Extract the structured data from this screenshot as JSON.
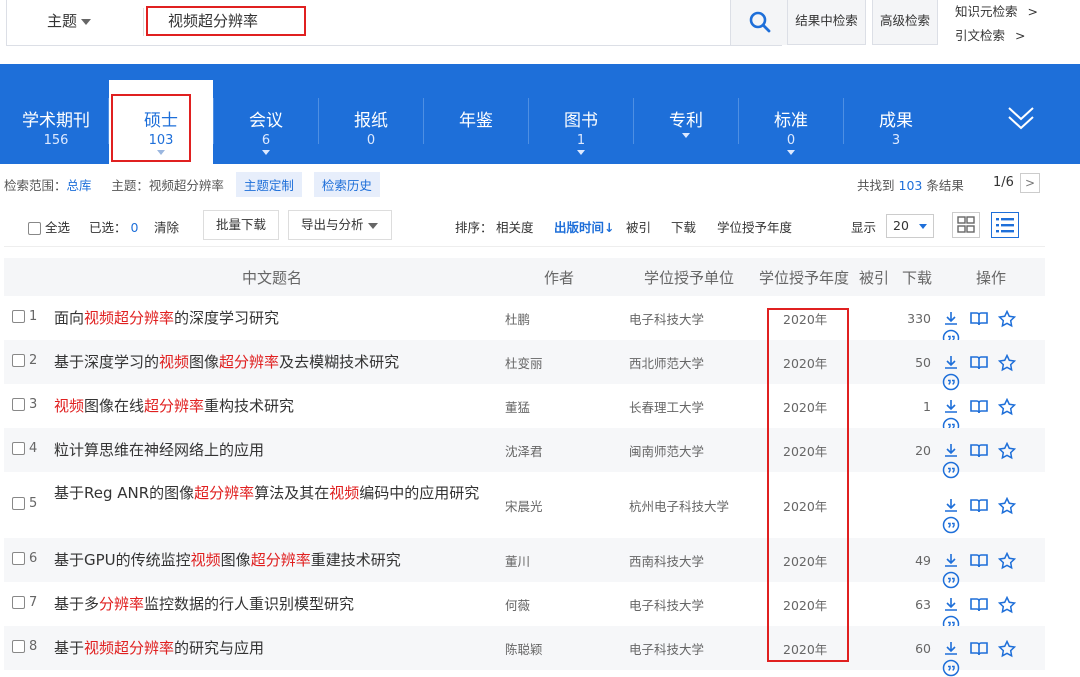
{
  "search": {
    "scope_label": "主题",
    "query": "视频超分辨率",
    "in_results": "结果中检索",
    "advanced": "高级检索",
    "knowledge": "知识元检索",
    "citation": "引文检索",
    "gt": ">"
  },
  "tabs": [
    {
      "label": "学术期刊",
      "count": "156",
      "arrow": false
    },
    {
      "label": "硕士",
      "count": "103",
      "arrow": true
    },
    {
      "label": "会议",
      "count": "6",
      "arrow": true
    },
    {
      "label": "报纸",
      "count": "0",
      "arrow": false
    },
    {
      "label": "年鉴",
      "count": "",
      "arrow": false
    },
    {
      "label": "图书",
      "count": "1",
      "arrow": true
    },
    {
      "label": "专利",
      "count": "",
      "arrow": true
    },
    {
      "label": "标准",
      "count": "0",
      "arrow": true
    },
    {
      "label": "成果",
      "count": "3",
      "arrow": false
    }
  ],
  "info": {
    "range_label": "检索范围：",
    "range_value": "总库",
    "topic_label": "主题：",
    "topic_value": "视频超分辨率",
    "custom": "主题定制",
    "history": "检索历史",
    "found_prefix": "共找到",
    "found_count": "103",
    "found_suffix": "条结果",
    "page": "1/6",
    "next": ">"
  },
  "toolbar": {
    "select_all": "全选",
    "selected_label": "已选：",
    "selected_count": "0",
    "clear": "清除",
    "batch_download": "批量下载",
    "export": "导出与分析",
    "sort_label": "排序：",
    "sort_relevance": "相关度",
    "sort_time": "出版时间",
    "sort_time_arrow": "↓",
    "sort_cited": "被引",
    "sort_download": "下载",
    "sort_year": "学位授予年度",
    "show_label": "显示",
    "show_value": "20"
  },
  "columns": {
    "title": "中文题名",
    "author": "作者",
    "unit": "学位授予单位",
    "year": "学位授予年度",
    "cited": "被引",
    "download": "下载",
    "ops": "操作"
  },
  "rows": [
    {
      "num": "1",
      "title": [
        [
          "面向",
          ""
        ],
        [
          "视频超分辨率",
          "hl"
        ],
        [
          "的深度学习研究",
          ""
        ]
      ],
      "author": "杜鹏",
      "unit": "电子科技大学",
      "year": "2020年",
      "downloads": "330"
    },
    {
      "num": "2",
      "title": [
        [
          "基于深度学习的",
          ""
        ],
        [
          "视频",
          "hl"
        ],
        [
          "图像",
          ""
        ],
        [
          "超分辨率",
          "hl"
        ],
        [
          "及去模糊技术研究",
          ""
        ]
      ],
      "author": "杜变丽",
      "unit": "西北师范大学",
      "year": "2020年",
      "downloads": "50"
    },
    {
      "num": "3",
      "title": [
        [
          "视频",
          "hl"
        ],
        [
          "图像在线",
          ""
        ],
        [
          "超分辨率",
          "hl"
        ],
        [
          "重构技术研究",
          ""
        ]
      ],
      "author": "董猛",
      "unit": "长春理工大学",
      "year": "2020年",
      "downloads": "1"
    },
    {
      "num": "4",
      "title": [
        [
          "粒计算思维在神经网络上的应用",
          ""
        ]
      ],
      "author": "沈泽君",
      "unit": "闽南师范大学",
      "year": "2020年",
      "downloads": "20"
    },
    {
      "num": "5",
      "title": [
        [
          "基于Reg ANR的图像",
          ""
        ],
        [
          "超分辨率",
          "hl"
        ],
        [
          "算法及其在",
          ""
        ],
        [
          "视频",
          "hl"
        ],
        [
          "编码中的应用研究",
          ""
        ]
      ],
      "author": "宋晨光",
      "unit": "杭州电子科技大学",
      "year": "2020年",
      "downloads": ""
    },
    {
      "num": "6",
      "title": [
        [
          "基于GPU的传统监控",
          ""
        ],
        [
          "视频",
          "hl"
        ],
        [
          "图像",
          ""
        ],
        [
          "超分辨率",
          "hl"
        ],
        [
          "重建技术研究",
          ""
        ]
      ],
      "author": "董川",
      "unit": "西南科技大学",
      "year": "2020年",
      "downloads": "49"
    },
    {
      "num": "7",
      "title": [
        [
          "基于多",
          ""
        ],
        [
          "分辨率",
          "hl"
        ],
        [
          "监控数据的行人重识别模型研究",
          ""
        ]
      ],
      "author": "何薇",
      "unit": "电子科技大学",
      "year": "2020年",
      "downloads": "63"
    },
    {
      "num": "8",
      "title": [
        [
          "基于",
          ""
        ],
        [
          "视频超分辨率",
          "hl"
        ],
        [
          "的研究与应用",
          ""
        ]
      ],
      "author": "陈聪颖",
      "unit": "电子科技大学",
      "year": "2020年",
      "downloads": "60"
    }
  ],
  "colors": {
    "brand": "#1e6fd9",
    "highlight": "#e02020"
  }
}
